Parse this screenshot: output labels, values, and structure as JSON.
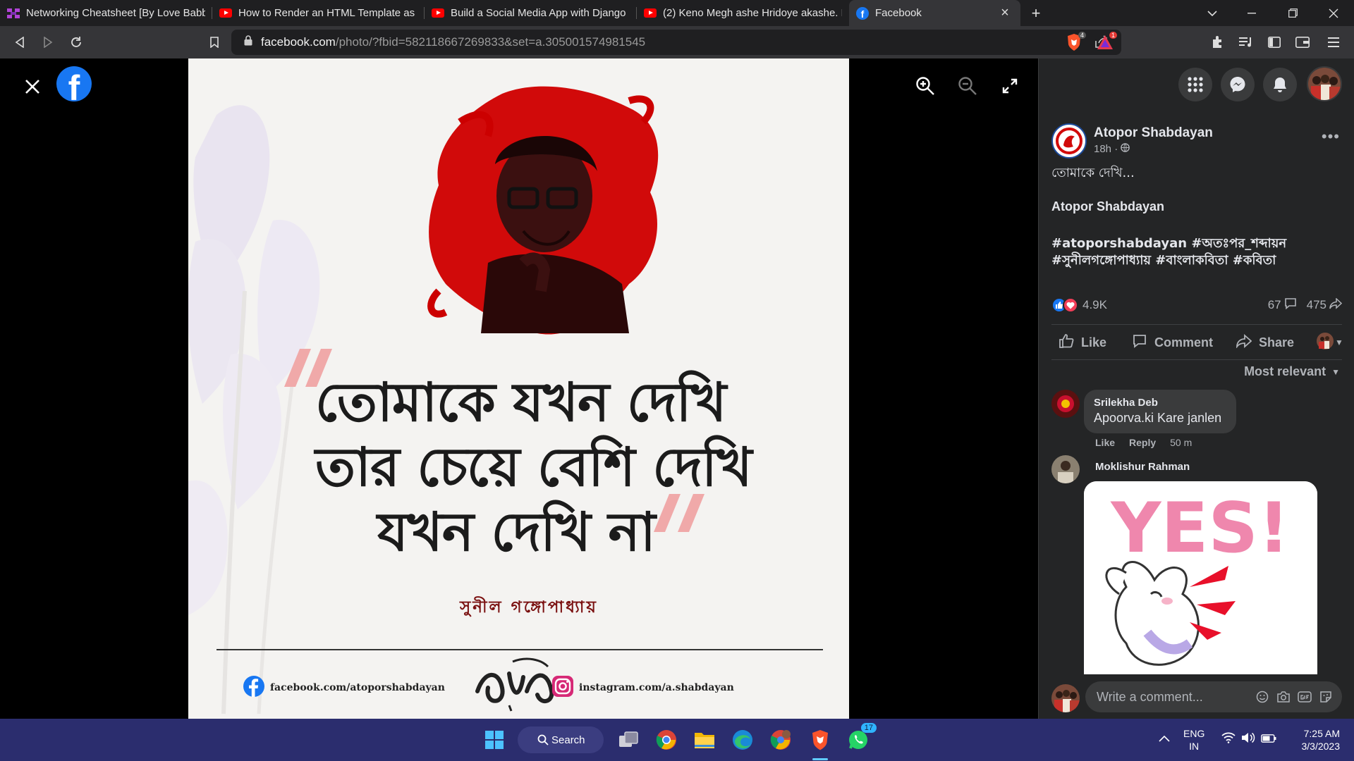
{
  "browser": {
    "tabs": [
      {
        "title": "Networking Cheatsheet [By Love Babb",
        "favicon": "course-icon"
      },
      {
        "title": "How to Render an HTML Template as",
        "favicon": "youtube-icon"
      },
      {
        "title": "Build a Social Media App with Django",
        "favicon": "youtube-icon"
      },
      {
        "title": "(2) Keno Megh ashe Hridoye akashe. B",
        "favicon": "youtube-icon"
      },
      {
        "title": "Facebook",
        "favicon": "facebook-icon",
        "active": true
      }
    ],
    "url_domain": "facebook.com",
    "url_path": "/photo/?fbid=582118667269833&set=a.305001574981545",
    "shields_badge": "4",
    "rewards_badge": "1"
  },
  "photo": {
    "quote_lines": [
      "তোমাকে যখন দেখি",
      "তার চেয়ে বেশি দেখি",
      "যখন দেখি না"
    ],
    "poet": "সুনীল গঙ্গোপাধ্যায়",
    "facebook_link": "facebook.com/atoporshabdayan",
    "instagram_link": "instagram.com/a.shabdayan"
  },
  "post": {
    "page_name": "Atopor Shabdayan",
    "time": "18h ·",
    "text_first": "তোমাকে দেখি...",
    "author_line": "Atopor Shabdayan",
    "hashtags_line1": "#atoporshabdayan #অতঃপর_শব্দায়ন",
    "hashtags_line2": "#সুনীলগঙ্গোপাধ্যায় #বাংলাকবিতা #কবিতা",
    "reactions_count": "4.9K",
    "comments_count": "67",
    "shares_count": "475",
    "actions": {
      "like": "Like",
      "comment": "Comment",
      "share": "Share"
    },
    "sort_label": "Most relevant"
  },
  "comments": [
    {
      "author": "Srilekha Deb",
      "text": "Apoorva.ki Kare janlen",
      "like": "Like",
      "reply": "Reply",
      "time": "50 m"
    },
    {
      "author": "Moklishur Rahman",
      "gif_text": "YES!"
    }
  ],
  "composer": {
    "placeholder": "Write a comment..."
  },
  "taskbar": {
    "search_label": "Search",
    "whatsapp_badge": "17",
    "lang_line1": "ENG",
    "lang_line2": "IN",
    "time": "7:25 AM",
    "date": "3/3/2023"
  },
  "colors": {
    "facebook_blue": "#1877f2",
    "panel_bg": "#242526",
    "taskbar_bg": "#2b2d6e",
    "poster_red": "#d10a0a"
  }
}
